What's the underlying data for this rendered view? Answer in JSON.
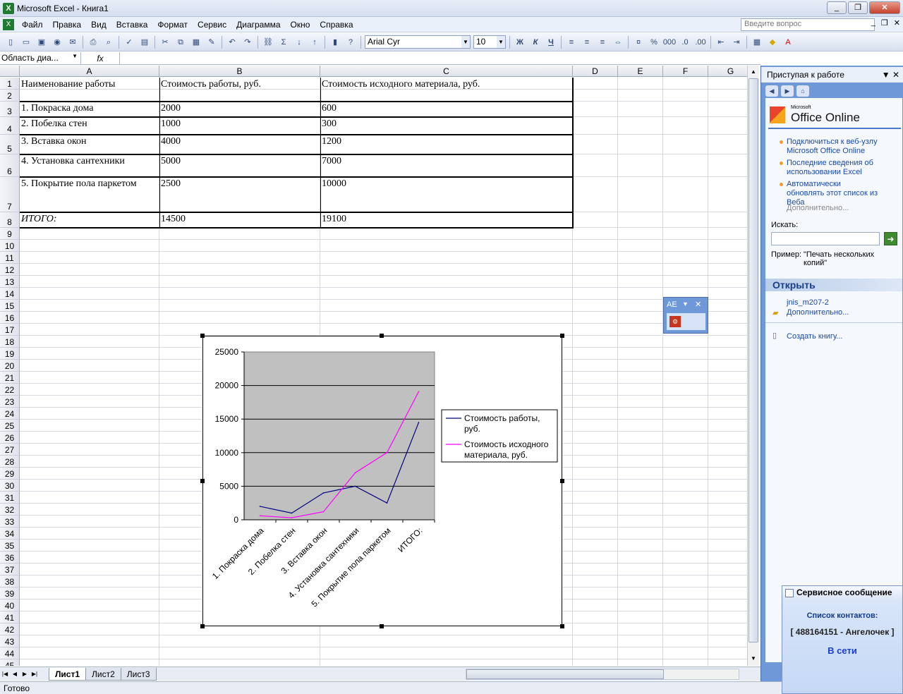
{
  "window": {
    "title": "Microsoft Excel - Книга1",
    "min": "_",
    "max": "❐",
    "close": "✕"
  },
  "menu": {
    "items": [
      "Файл",
      "Правка",
      "Вид",
      "Вставка",
      "Формат",
      "Сервис",
      "Диаграмма",
      "Окно",
      "Справка"
    ],
    "ask_placeholder": "Введите вопрос"
  },
  "toolbar": {
    "font": "Arial Cyr",
    "size": "10",
    "bold": "Ж",
    "italic": "К",
    "underline": "Ч"
  },
  "formula_bar": {
    "name_box": "Область диа...",
    "fx": "fx",
    "content": ""
  },
  "columns": [
    "A",
    "B",
    "C",
    "D",
    "E",
    "F",
    "G"
  ],
  "rows": [
    "1",
    "2",
    "3",
    "4",
    "5",
    "6",
    "7",
    "8",
    "9",
    "10",
    "11",
    "12",
    "13",
    "14",
    "15",
    "16",
    "17",
    "18",
    "19",
    "20",
    "21",
    "22",
    "23",
    "24",
    "25",
    "26",
    "27",
    "28",
    "29",
    "30",
    "31",
    "32",
    "33",
    "34",
    "35",
    "36",
    "37",
    "38",
    "39",
    "40",
    "41",
    "42",
    "43",
    "44",
    "45"
  ],
  "table": {
    "header": [
      "Наименование работы",
      "Стоимость работы, руб.",
      "Стоимость исходного материала, руб."
    ],
    "rows": [
      [
        "1. Покраска дома",
        "2000",
        "600"
      ],
      [
        "2. Побелка стен",
        "1000",
        "300"
      ],
      [
        "3. Вставка окон",
        "4000",
        "1200"
      ],
      [
        "4. Установка сантехники",
        "5000",
        "7000"
      ],
      [
        "5. Покрытие пола паркетом",
        "2500",
        "10000"
      ],
      [
        "ИТОГО:",
        "14500",
        "19100"
      ]
    ]
  },
  "chart_data": {
    "type": "line",
    "categories": [
      "1. Покраска дома",
      "2. Побелка стен",
      "3. Вставка окон",
      "4. Установка сантехники",
      "5. Покрытие пола паркетом",
      "ИТОГО:"
    ],
    "series": [
      {
        "name": "Стоимость работы, руб.",
        "values": [
          2000,
          1000,
          4000,
          5000,
          2500,
          14500
        ],
        "color": "#000080"
      },
      {
        "name": "Стоимость исходного материала, руб.",
        "values": [
          600,
          300,
          1200,
          7000,
          10000,
          19100
        ],
        "color": "#ff00ff"
      }
    ],
    "yticks": [
      "25000",
      "20000",
      "15000",
      "10000",
      "5000",
      "0"
    ],
    "ylim": [
      0,
      25000
    ],
    "grid": true,
    "plot_background": "#c0c0c0",
    "legend_position": "right"
  },
  "sheets": [
    "Лист1",
    "Лист2",
    "Лист3"
  ],
  "status": "Готово",
  "task_pane": {
    "title": "Приступая к работе",
    "logo_small": "Microsoft",
    "logo": "Office Online",
    "links": [
      "Подключиться к веб-узлу Microsoft Office Online",
      "Последние сведения об использовании Excel",
      "Автоматически обновлять этот список из Веба"
    ],
    "more": "Дополнительно...",
    "search_label": "Искать:",
    "example_label": "Пример:",
    "example_text": "\"Печать нескольких копий\"",
    "open_title": "Открыть",
    "recent_file": "jnis_m207-2",
    "open_more": "Дополнительно...",
    "create": "Создать книгу..."
  },
  "float_toolbar": {
    "label": "АЕ"
  },
  "notification": {
    "title": "Сервисное сообщение",
    "line1": "Список контактов:",
    "line2": "[ 488164151 - Ангелочек ]",
    "line3": "В сети"
  }
}
